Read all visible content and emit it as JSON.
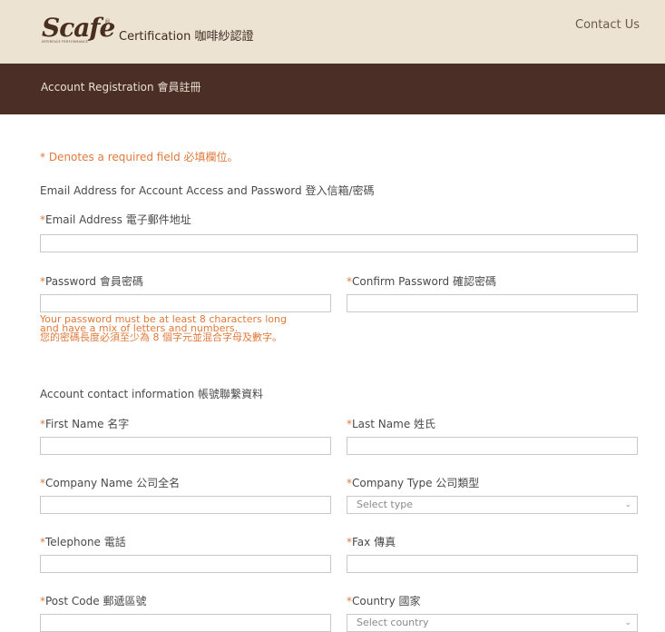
{
  "header": {
    "logo_text": "Scafe",
    "logo_tagline": "INTERFACE PERFORMANCE",
    "site_title": "Certification 咖啡紗認證",
    "contact_link": "Contact Us"
  },
  "banner": {
    "title": "Account Registration 會員註冊"
  },
  "form": {
    "required_note": "* Denotes a required field 必填欄位。",
    "section_login": "Email Address for Account Access and Password 登入信箱/密碼",
    "email_label": "Email Address 電子郵件地址",
    "password_label": "Password 會員密碼",
    "confirm_password_label": "Confirm Password 確認密碼",
    "password_help": [
      "Your password must be at least 8 characters long",
      "and have a mix of letters and numbers.",
      "您的密碼長度必須至少為 8 個字元並混合字母及數字。"
    ],
    "section_contact": "Account contact information 帳號聯繫資料",
    "first_name_label": "First Name 名字",
    "last_name_label": "Last Name 姓氏",
    "company_name_label": "Company Name 公司全名",
    "company_type_label": "Company Type 公司類型",
    "company_type_value": "Select type",
    "telephone_label": "Telephone 電話",
    "fax_label": "Fax 傳真",
    "post_code_label": "Post Code 郵遞區號",
    "country_label": "Country 國家",
    "country_value": "Select country",
    "required_mark": "*"
  },
  "icons": {
    "select_chevron": "chevron-down-icon"
  },
  "colors": {
    "topbar_bg": "#ece3d3",
    "banner_bg": "#4b2f26",
    "required_accent": "#e07a3c"
  }
}
